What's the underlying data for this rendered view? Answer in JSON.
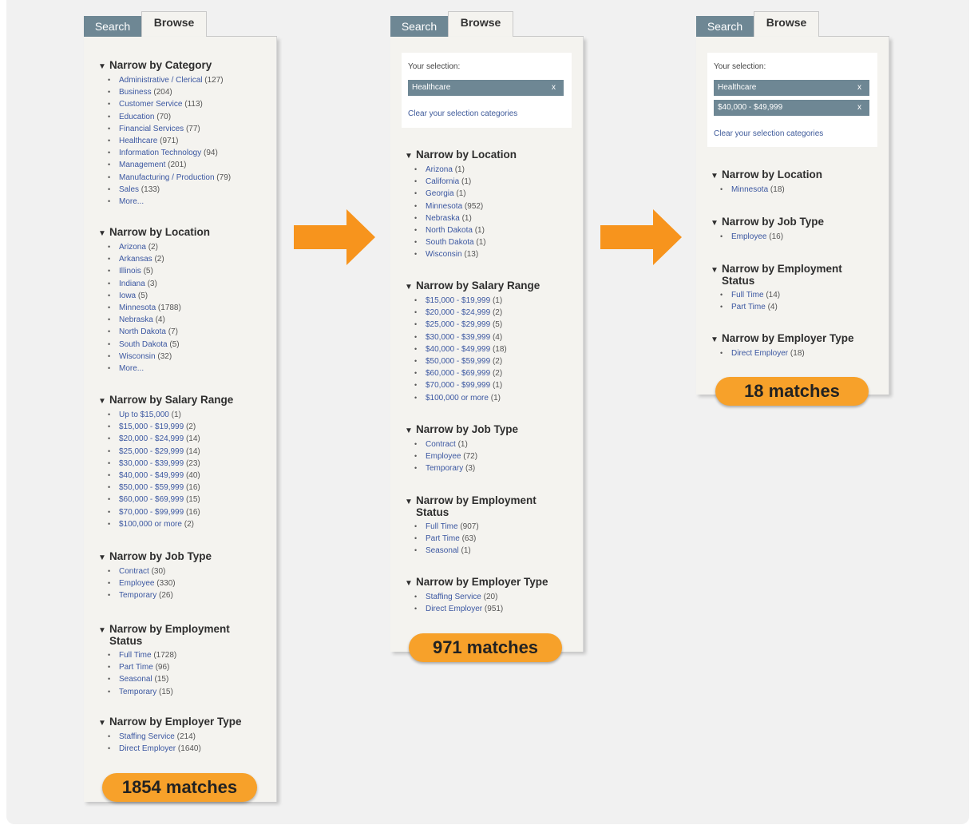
{
  "colors": {
    "accent": "#f7a12a",
    "tab": "#6e8794",
    "link": "#3b57a1",
    "panel": "#f4f3ef"
  },
  "tabs": {
    "search": "Search",
    "browse": "Browse"
  },
  "selection_label": "Your selection:",
  "clear_label": "Clear your selection categories",
  "more_label": "More...",
  "panels": [
    {
      "badge": "1854 matches",
      "chips": [],
      "sections": [
        {
          "title": "Narrow by Category",
          "items": [
            {
              "label": "Administrative / Clerical",
              "count": "(127)"
            },
            {
              "label": "Business",
              "count": "(204)"
            },
            {
              "label": "Customer Service",
              "count": "(113)"
            },
            {
              "label": "Education",
              "count": "(70)"
            },
            {
              "label": "Financial Services",
              "count": "(77)"
            },
            {
              "label": "Healthcare",
              "count": "(971)"
            },
            {
              "label": "Information Technology",
              "count": "(94)"
            },
            {
              "label": "Management",
              "count": "(201)"
            },
            {
              "label": "Manufacturing / Production",
              "count": "(79)"
            },
            {
              "label": "Sales",
              "count": "(133)"
            },
            {
              "label": "More...",
              "count": ""
            }
          ]
        },
        {
          "title": "Narrow by Location",
          "items": [
            {
              "label": "Arizona",
              "count": "(2)"
            },
            {
              "label": "Arkansas",
              "count": "(2)"
            },
            {
              "label": "Illinois",
              "count": "(5)"
            },
            {
              "label": "Indiana",
              "count": "(3)"
            },
            {
              "label": "Iowa",
              "count": "(5)"
            },
            {
              "label": "Minnesota",
              "count": "(1788)"
            },
            {
              "label": "Nebraska",
              "count": "(4)"
            },
            {
              "label": "North Dakota",
              "count": "(7)"
            },
            {
              "label": "South Dakota",
              "count": "(5)"
            },
            {
              "label": "Wisconsin",
              "count": "(32)"
            },
            {
              "label": "More...",
              "count": ""
            }
          ]
        },
        {
          "title": "Narrow by Salary Range",
          "items": [
            {
              "label": "Up to $15,000",
              "count": "(1)"
            },
            {
              "label": "$15,000 - $19,999",
              "count": "(2)"
            },
            {
              "label": "$20,000 - $24,999",
              "count": "(14)"
            },
            {
              "label": "$25,000 - $29,999",
              "count": "(14)"
            },
            {
              "label": "$30,000 - $39,999",
              "count": "(23)"
            },
            {
              "label": "$40,000 - $49,999",
              "count": "(40)"
            },
            {
              "label": "$50,000 - $59,999",
              "count": "(16)"
            },
            {
              "label": "$60,000 - $69,999",
              "count": "(15)"
            },
            {
              "label": "$70,000 - $99,999",
              "count": "(16)"
            },
            {
              "label": "$100,000 or more",
              "count": "(2)"
            }
          ]
        },
        {
          "title": "Narrow by Job Type",
          "items": [
            {
              "label": "Contract",
              "count": "(30)"
            },
            {
              "label": "Employee",
              "count": "(330)"
            },
            {
              "label": "Temporary",
              "count": "(26)"
            }
          ]
        },
        {
          "title": "Narrow by Employment\nStatus",
          "items": [
            {
              "label": "Full Time",
              "count": "(1728)"
            },
            {
              "label": "Part Time",
              "count": "(96)"
            },
            {
              "label": "Seasonal",
              "count": "(15)"
            },
            {
              "label": "Temporary",
              "count": "(15)"
            }
          ]
        },
        {
          "title": "Narrow by Employer Type",
          "items": [
            {
              "label": "Staffing Service",
              "count": "(214)"
            },
            {
              "label": "Direct Employer",
              "count": "(1640)"
            }
          ]
        }
      ]
    },
    {
      "badge": "971 matches",
      "chips": [
        "Healthcare"
      ],
      "sections": [
        {
          "title": "Narrow by Location",
          "items": [
            {
              "label": "Arizona",
              "count": "(1)"
            },
            {
              "label": "California",
              "count": "(1)"
            },
            {
              "label": "Georgia",
              "count": "(1)"
            },
            {
              "label": "Minnesota",
              "count": "(952)"
            },
            {
              "label": "Nebraska",
              "count": "(1)"
            },
            {
              "label": "North Dakota",
              "count": "(1)"
            },
            {
              "label": "South Dakota",
              "count": "(1)"
            },
            {
              "label": "Wisconsin",
              "count": "(13)"
            }
          ]
        },
        {
          "title": "Narrow by Salary Range",
          "items": [
            {
              "label": "$15,000 - $19,999",
              "count": "(1)"
            },
            {
              "label": "$20,000 - $24,999",
              "count": "(2)"
            },
            {
              "label": "$25,000 - $29,999",
              "count": "(5)"
            },
            {
              "label": "$30,000 - $39,999",
              "count": "(4)"
            },
            {
              "label": "$40,000 - $49,999",
              "count": "(18)"
            },
            {
              "label": "$50,000 - $59,999",
              "count": "(2)"
            },
            {
              "label": "$60,000 - $69,999",
              "count": "(2)"
            },
            {
              "label": "$70,000 - $99,999",
              "count": "(1)"
            },
            {
              "label": "$100,000 or more",
              "count": "(1)"
            }
          ]
        },
        {
          "title": "Narrow by Job Type",
          "items": [
            {
              "label": "Contract",
              "count": "(1)"
            },
            {
              "label": "Employee",
              "count": "(72)"
            },
            {
              "label": "Temporary",
              "count": "(3)"
            }
          ]
        },
        {
          "title": "Narrow by Employment\nStatus",
          "items": [
            {
              "label": "Full Time",
              "count": "(907)"
            },
            {
              "label": "Part Time",
              "count": "(63)"
            },
            {
              "label": "Seasonal",
              "count": "(1)"
            }
          ]
        },
        {
          "title": "Narrow by Employer Type",
          "items": [
            {
              "label": "Staffing Service",
              "count": "(20)"
            },
            {
              "label": "Direct Employer",
              "count": "(951)"
            }
          ]
        }
      ]
    },
    {
      "badge": "18 matches",
      "chips": [
        "Healthcare",
        "$40,000 - $49,999"
      ],
      "sections": [
        {
          "title": "Narrow by Location",
          "items": [
            {
              "label": "Minnesota",
              "count": "(18)"
            }
          ]
        },
        {
          "title": "Narrow by Job Type",
          "items": [
            {
              "label": "Employee",
              "count": "(16)"
            }
          ]
        },
        {
          "title": "Narrow by Employment\nStatus",
          "items": [
            {
              "label": "Full Time",
              "count": "(14)"
            },
            {
              "label": "Part Time",
              "count": "(4)"
            }
          ]
        },
        {
          "title": "Narrow by Employer Type",
          "items": [
            {
              "label": "Direct Employer",
              "count": "(18)"
            }
          ]
        }
      ]
    }
  ]
}
